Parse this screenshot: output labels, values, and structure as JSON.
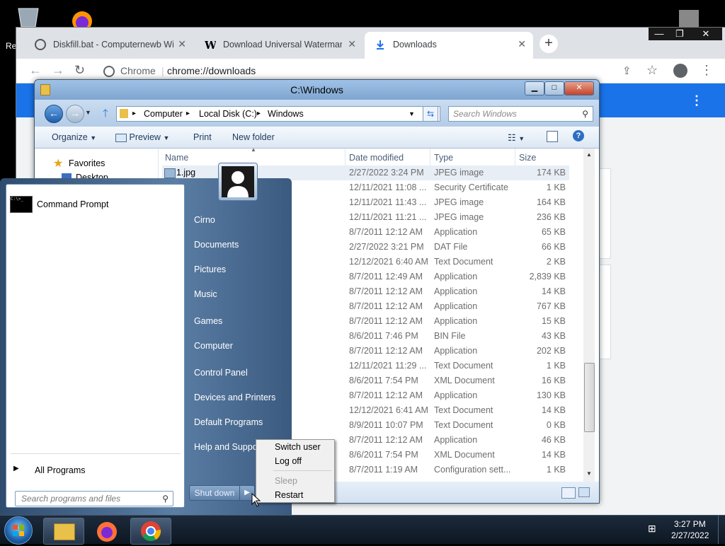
{
  "desktop": {
    "partial_label": "Re"
  },
  "chrome": {
    "tabs": [
      {
        "label": "Diskfill.bat - Computernewb Wiki"
      },
      {
        "label": "Download Universal Watermark D"
      },
      {
        "label": "Downloads"
      }
    ],
    "new_tab": "+",
    "window_buttons": {
      "minimize": "—",
      "maximize": "❐",
      "close": "✕"
    },
    "address_label": "Chrome",
    "address_url": "chrome://downloads",
    "menu_icon": "⋮"
  },
  "explorer": {
    "title": "C:\\Windows",
    "breadcrumb": [
      "Computer",
      "Local Disk (C:)",
      "Windows"
    ],
    "search_placeholder": "Search Windows",
    "commands": {
      "organize": "Organize",
      "preview": "Preview",
      "print": "Print",
      "new_folder": "New folder"
    },
    "nav": {
      "favorites": "Favorites",
      "desktop": "Desktop"
    },
    "columns": {
      "name": "Name",
      "date": "Date modified",
      "type": "Type",
      "size": "Size"
    },
    "files": [
      {
        "name": "1.jpg",
        "date": "2/27/2022 3:24 PM",
        "type": "JPEG image",
        "size": "174 KB"
      },
      {
        "name": "",
        "date": "12/11/2021 11:08 ...",
        "type": "Security Certificate",
        "size": "1 KB"
      },
      {
        "name": "",
        "date": "12/11/2021 11:43 ...",
        "type": "JPEG image",
        "size": "164 KB"
      },
      {
        "name": "",
        "date": "12/11/2021 11:21 ...",
        "type": "JPEG image",
        "size": "236 KB"
      },
      {
        "name": "",
        "date": "8/7/2011 12:12 AM",
        "type": "Application",
        "size": "65 KB"
      },
      {
        "name": "",
        "date": "2/27/2022 3:21 PM",
        "type": "DAT File",
        "size": "66 KB"
      },
      {
        "name": "",
        "date": "12/12/2021 6:40 AM",
        "type": "Text Document",
        "size": "2 KB"
      },
      {
        "name": "",
        "date": "8/7/2011 12:49 AM",
        "type": "Application",
        "size": "2,839 KB"
      },
      {
        "name": "",
        "date": "8/7/2011 12:12 AM",
        "type": "Application",
        "size": "14 KB"
      },
      {
        "name": "",
        "date": "8/7/2011 12:12 AM",
        "type": "Application",
        "size": "767 KB"
      },
      {
        "name": "",
        "date": "8/7/2011 12:12 AM",
        "type": "Application",
        "size": "15 KB"
      },
      {
        "name": "",
        "date": "8/6/2011 7:46 PM",
        "type": "BIN File",
        "size": "43 KB"
      },
      {
        "name": "",
        "date": "8/7/2011 12:12 AM",
        "type": "Application",
        "size": "202 KB"
      },
      {
        "name": "",
        "date": "12/11/2021 11:29 ...",
        "type": "Text Document",
        "size": "1 KB"
      },
      {
        "name": "",
        "date": "8/6/2011 7:54 PM",
        "type": "XML Document",
        "size": "16 KB"
      },
      {
        "name": "",
        "date": "8/7/2011 12:12 AM",
        "type": "Application",
        "size": "130 KB"
      },
      {
        "name": "",
        "date": "12/12/2021 6:41 AM",
        "type": "Text Document",
        "size": "14 KB"
      },
      {
        "name": "",
        "date": "8/9/2011 10:07 PM",
        "type": "Text Document",
        "size": "0 KB"
      },
      {
        "name": "",
        "date": "8/7/2011 12:12 AM",
        "type": "Application",
        "size": "46 KB"
      },
      {
        "name": "",
        "date": "8/6/2011 7:54 PM",
        "type": "XML Document",
        "size": "14 KB"
      },
      {
        "name": "",
        "date": "8/7/2011 1:19 AM",
        "type": "Configuration sett...",
        "size": "1 KB"
      }
    ]
  },
  "start_menu": {
    "pinned": [
      {
        "label": "Command Prompt"
      }
    ],
    "all_programs": "All Programs",
    "search_placeholder": "Search programs and files",
    "right_items": [
      "Cirno",
      "Documents",
      "Pictures",
      "Music",
      "Games",
      "Computer",
      "Control Panel",
      "Devices and Printers",
      "Default Programs",
      "Help and Support"
    ],
    "shutdown": "Shut down"
  },
  "shutdown_menu": {
    "items": [
      {
        "label": "Switch user",
        "enabled": true
      },
      {
        "label": "Log off",
        "enabled": true
      },
      {
        "label": "Sleep",
        "enabled": false
      },
      {
        "label": "Restart",
        "enabled": true
      }
    ]
  },
  "taskbar": {
    "time": "3:27 PM",
    "date": "2/27/2022"
  }
}
